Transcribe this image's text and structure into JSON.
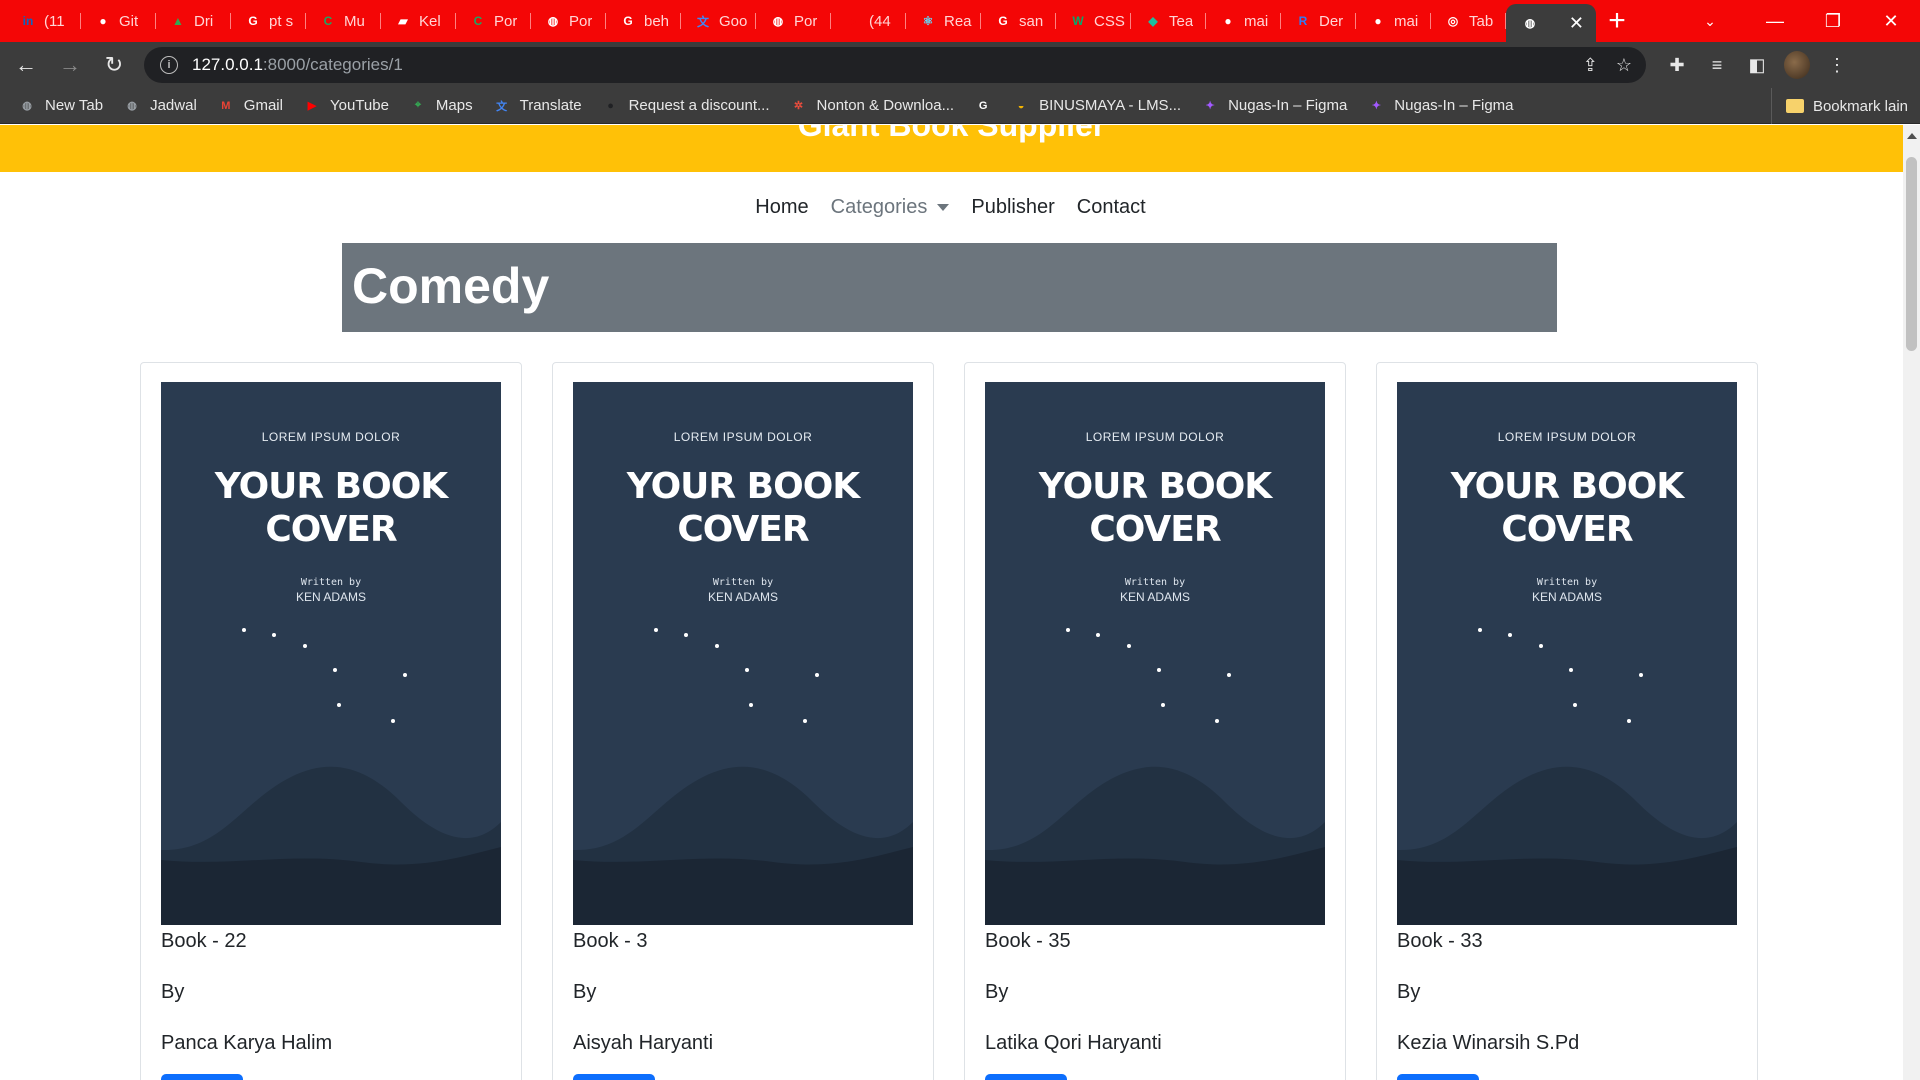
{
  "browser": {
    "tabs": [
      {
        "title": "(11",
        "icon": "linkedin-icon",
        "color": "#0a66c2",
        "glyph": "in"
      },
      {
        "title": "Git",
        "icon": "github-icon",
        "color": "#ffffff",
        "glyph": "●"
      },
      {
        "title": "Dri",
        "icon": "drive-icon",
        "color": "#34a853",
        "glyph": "▲"
      },
      {
        "title": "pt s",
        "icon": "google-icon",
        "color": "#ffffff",
        "glyph": "G"
      },
      {
        "title": "Mu",
        "icon": "c-app-icon",
        "color": "#1fa463",
        "glyph": "C"
      },
      {
        "title": "Kel",
        "icon": "classroom-icon",
        "color": "#ffffff",
        "glyph": "▰"
      },
      {
        "title": "Por",
        "icon": "c-app-icon",
        "color": "#1fa463",
        "glyph": "C"
      },
      {
        "title": "Por",
        "icon": "globe-icon",
        "color": "#ffffff",
        "glyph": "◍"
      },
      {
        "title": "beh",
        "icon": "google-icon",
        "color": "#ffffff",
        "glyph": "G"
      },
      {
        "title": "Goo",
        "icon": "translate-icon",
        "color": "#4285f4",
        "glyph": "文"
      },
      {
        "title": "Por",
        "icon": "globe-icon",
        "color": "#ffffff",
        "glyph": "◍"
      },
      {
        "title": "(44",
        "icon": "youtube-icon",
        "color": "#f40606",
        "glyph": "▸"
      },
      {
        "title": "Rea",
        "icon": "react-icon",
        "color": "#61dafb",
        "glyph": "⚛"
      },
      {
        "title": "san",
        "icon": "google-icon",
        "color": "#ffffff",
        "glyph": "G"
      },
      {
        "title": "CSS",
        "icon": "w3-icon",
        "color": "#04aa6d",
        "glyph": "W"
      },
      {
        "title": "Tea",
        "icon": "diamond-icon",
        "color": "#1dbf9f",
        "glyph": "◆"
      },
      {
        "title": "mai",
        "icon": "github-icon",
        "color": "#ffffff",
        "glyph": "●"
      },
      {
        "title": "Der",
        "icon": "r-app-icon",
        "color": "#2f7cf6",
        "glyph": "R"
      },
      {
        "title": "mai",
        "icon": "github-icon",
        "color": "#ffffff",
        "glyph": "●"
      },
      {
        "title": "Tab",
        "icon": "chrome-icon",
        "color": "#ffffff",
        "glyph": "◎"
      }
    ],
    "active_tab_icon": "globe-icon",
    "url_host": "127.0.0.1",
    "url_path": ":8000/categories/1",
    "bookmarks": [
      {
        "label": "New Tab",
        "icon": "globe-icon",
        "color": "#9aa0a6",
        "glyph": "◍"
      },
      {
        "label": "Jadwal",
        "icon": "globe-icon",
        "color": "#9aa0a6",
        "glyph": "◍"
      },
      {
        "label": "Gmail",
        "icon": "gmail-icon",
        "color": "#ea4335",
        "glyph": "M"
      },
      {
        "label": "YouTube",
        "icon": "youtube-icon",
        "color": "#ff0000",
        "glyph": "▶"
      },
      {
        "label": "Maps",
        "icon": "maps-icon",
        "color": "#34a853",
        "glyph": "⌖"
      },
      {
        "label": "Translate",
        "icon": "translate-icon",
        "color": "#4285f4",
        "glyph": "文"
      },
      {
        "label": "Request a discount...",
        "icon": "github-icon",
        "color": "#202124",
        "glyph": "●"
      },
      {
        "label": "Nonton & Downloa...",
        "icon": "pinwheel-icon",
        "color": "#e84c3d",
        "glyph": "✲"
      },
      {
        "label": "",
        "icon": "google-icon",
        "color": "#ffffff",
        "glyph": "G"
      },
      {
        "label": "BINUSMAYA - LMS...",
        "icon": "binus-icon",
        "color": "#f4b400",
        "glyph": "◒"
      },
      {
        "label": "Nugas-In – Figma",
        "icon": "figma-icon",
        "color": "#a259ff",
        "glyph": "✦"
      },
      {
        "label": "Nugas-In – Figma",
        "icon": "figma-icon",
        "color": "#a259ff",
        "glyph": "✦"
      }
    ],
    "other_bookmarks": "Bookmark lain"
  },
  "page": {
    "brand": "Giant Book Supplier",
    "nav": {
      "home": "Home",
      "categories": "Categories",
      "publisher": "Publisher",
      "contact": "Contact"
    },
    "category_title": "Comedy",
    "by_label": "By",
    "cover": {
      "kicker": "LOREM IPSUM DOLOR",
      "title_line1": "YOUR BOOK",
      "title_line2": "COVER",
      "written_by": "Written by",
      "author": "KEN ADAMS"
    },
    "books": [
      {
        "title": "Book - 22",
        "writer": "Panca Karya Halim"
      },
      {
        "title": "Book - 3",
        "writer": "Aisyah Haryanti"
      },
      {
        "title": "Book - 35",
        "writer": "Latika Qori Haryanti"
      },
      {
        "title": "Book - 33",
        "writer": "Kezia Winarsih S.Pd"
      }
    ]
  },
  "colors": {
    "tabstrip": "#f40606",
    "banner": "#ffc107",
    "heading": "#6c757d",
    "cover": "#2a3b50",
    "button": "#0d6efd"
  }
}
